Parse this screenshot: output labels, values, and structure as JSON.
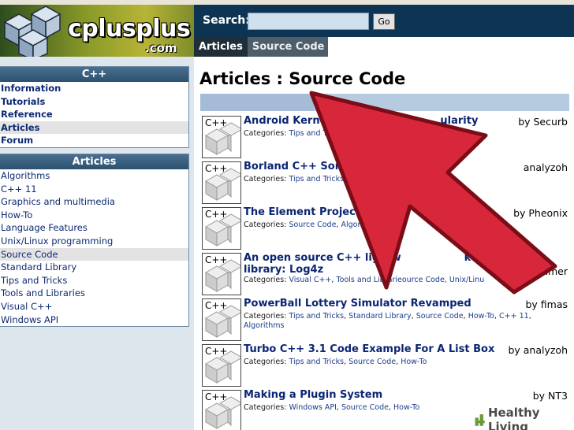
{
  "header": {
    "brand": "cplusplus",
    "brand_suffix": ".com",
    "search_label": "Search:",
    "search_value": "",
    "go_label": "Go",
    "breadcrumb": [
      "Articles",
      "Source Code"
    ]
  },
  "sidebar": {
    "cpp_title": "C++",
    "cpp_items": [
      "Information",
      "Tutorials",
      "Reference",
      "Articles",
      "Forum"
    ],
    "cpp_active": "Articles",
    "articles_title": "Articles",
    "article_items": [
      "Algorithms",
      "C++ 11",
      "Graphics and multimedia",
      "How-To",
      "Language Features",
      "Unix/Linux programming",
      "Source Code",
      "Standard Library",
      "Tips and Tricks",
      "Tools and Libraries",
      "Visual C++",
      "Windows API"
    ],
    "articles_active": "Source Code"
  },
  "main": {
    "title": "Articles : Source Code",
    "categories_label": "Categories:",
    "thumb_label": "C++",
    "articles": [
      {
        "title": "Android Kerne",
        "title_tail": "ularity",
        "author": "by Securb",
        "cats": [
          "Tips and T"
        ],
        "cats_tail": "11"
      },
      {
        "title": "Borland C++ Sorti",
        "title_tail": "",
        "author": "analyzoh",
        "cats": [
          "Tips and Tricks"
        ],
        "cats_tail": ""
      },
      {
        "title": "The Element Project (",
        "title_tail": "",
        "author": "by Pheonix",
        "cats": [
          "Source Code",
          "Algorith"
        ],
        "cats_tail": ""
      },
      {
        "title": "An open source C++ lightw",
        "title_line2": "library: Log4z",
        "title_tail": "k cross p",
        "author": "mmer",
        "cats": [
          "Visual C++",
          "Tools and Librarie"
        ],
        "cats_tail": "ource Code, Unix/Linu"
      },
      {
        "title": "PowerBall Lottery Simulator Revamped",
        "title_tail": "",
        "author": "by fimas",
        "cats": [
          "Tips and Tricks",
          "Standard Library",
          "Source Code",
          "How-To",
          "C++ 11"
        ],
        "cats_line2": "Algorithms"
      },
      {
        "title": "Turbo C++ 3.1 Code Example For A List Box",
        "title_tail": "",
        "author": "by analyzoh",
        "cats": [
          "Tips and Tricks",
          "Source Code",
          "How-To"
        ]
      },
      {
        "title": "Making a Plugin System",
        "title_tail": "",
        "author": "by NT3",
        "cats": [
          "Windows API",
          "Source Code",
          "How-To"
        ]
      }
    ]
  },
  "watermark": {
    "text": "Healthy Living",
    "icon": "wikihow-logo-icon"
  },
  "colors": {
    "accent_red": "#d8263a",
    "header_navy": "#0d3553",
    "link_blue": "#0b2572"
  }
}
